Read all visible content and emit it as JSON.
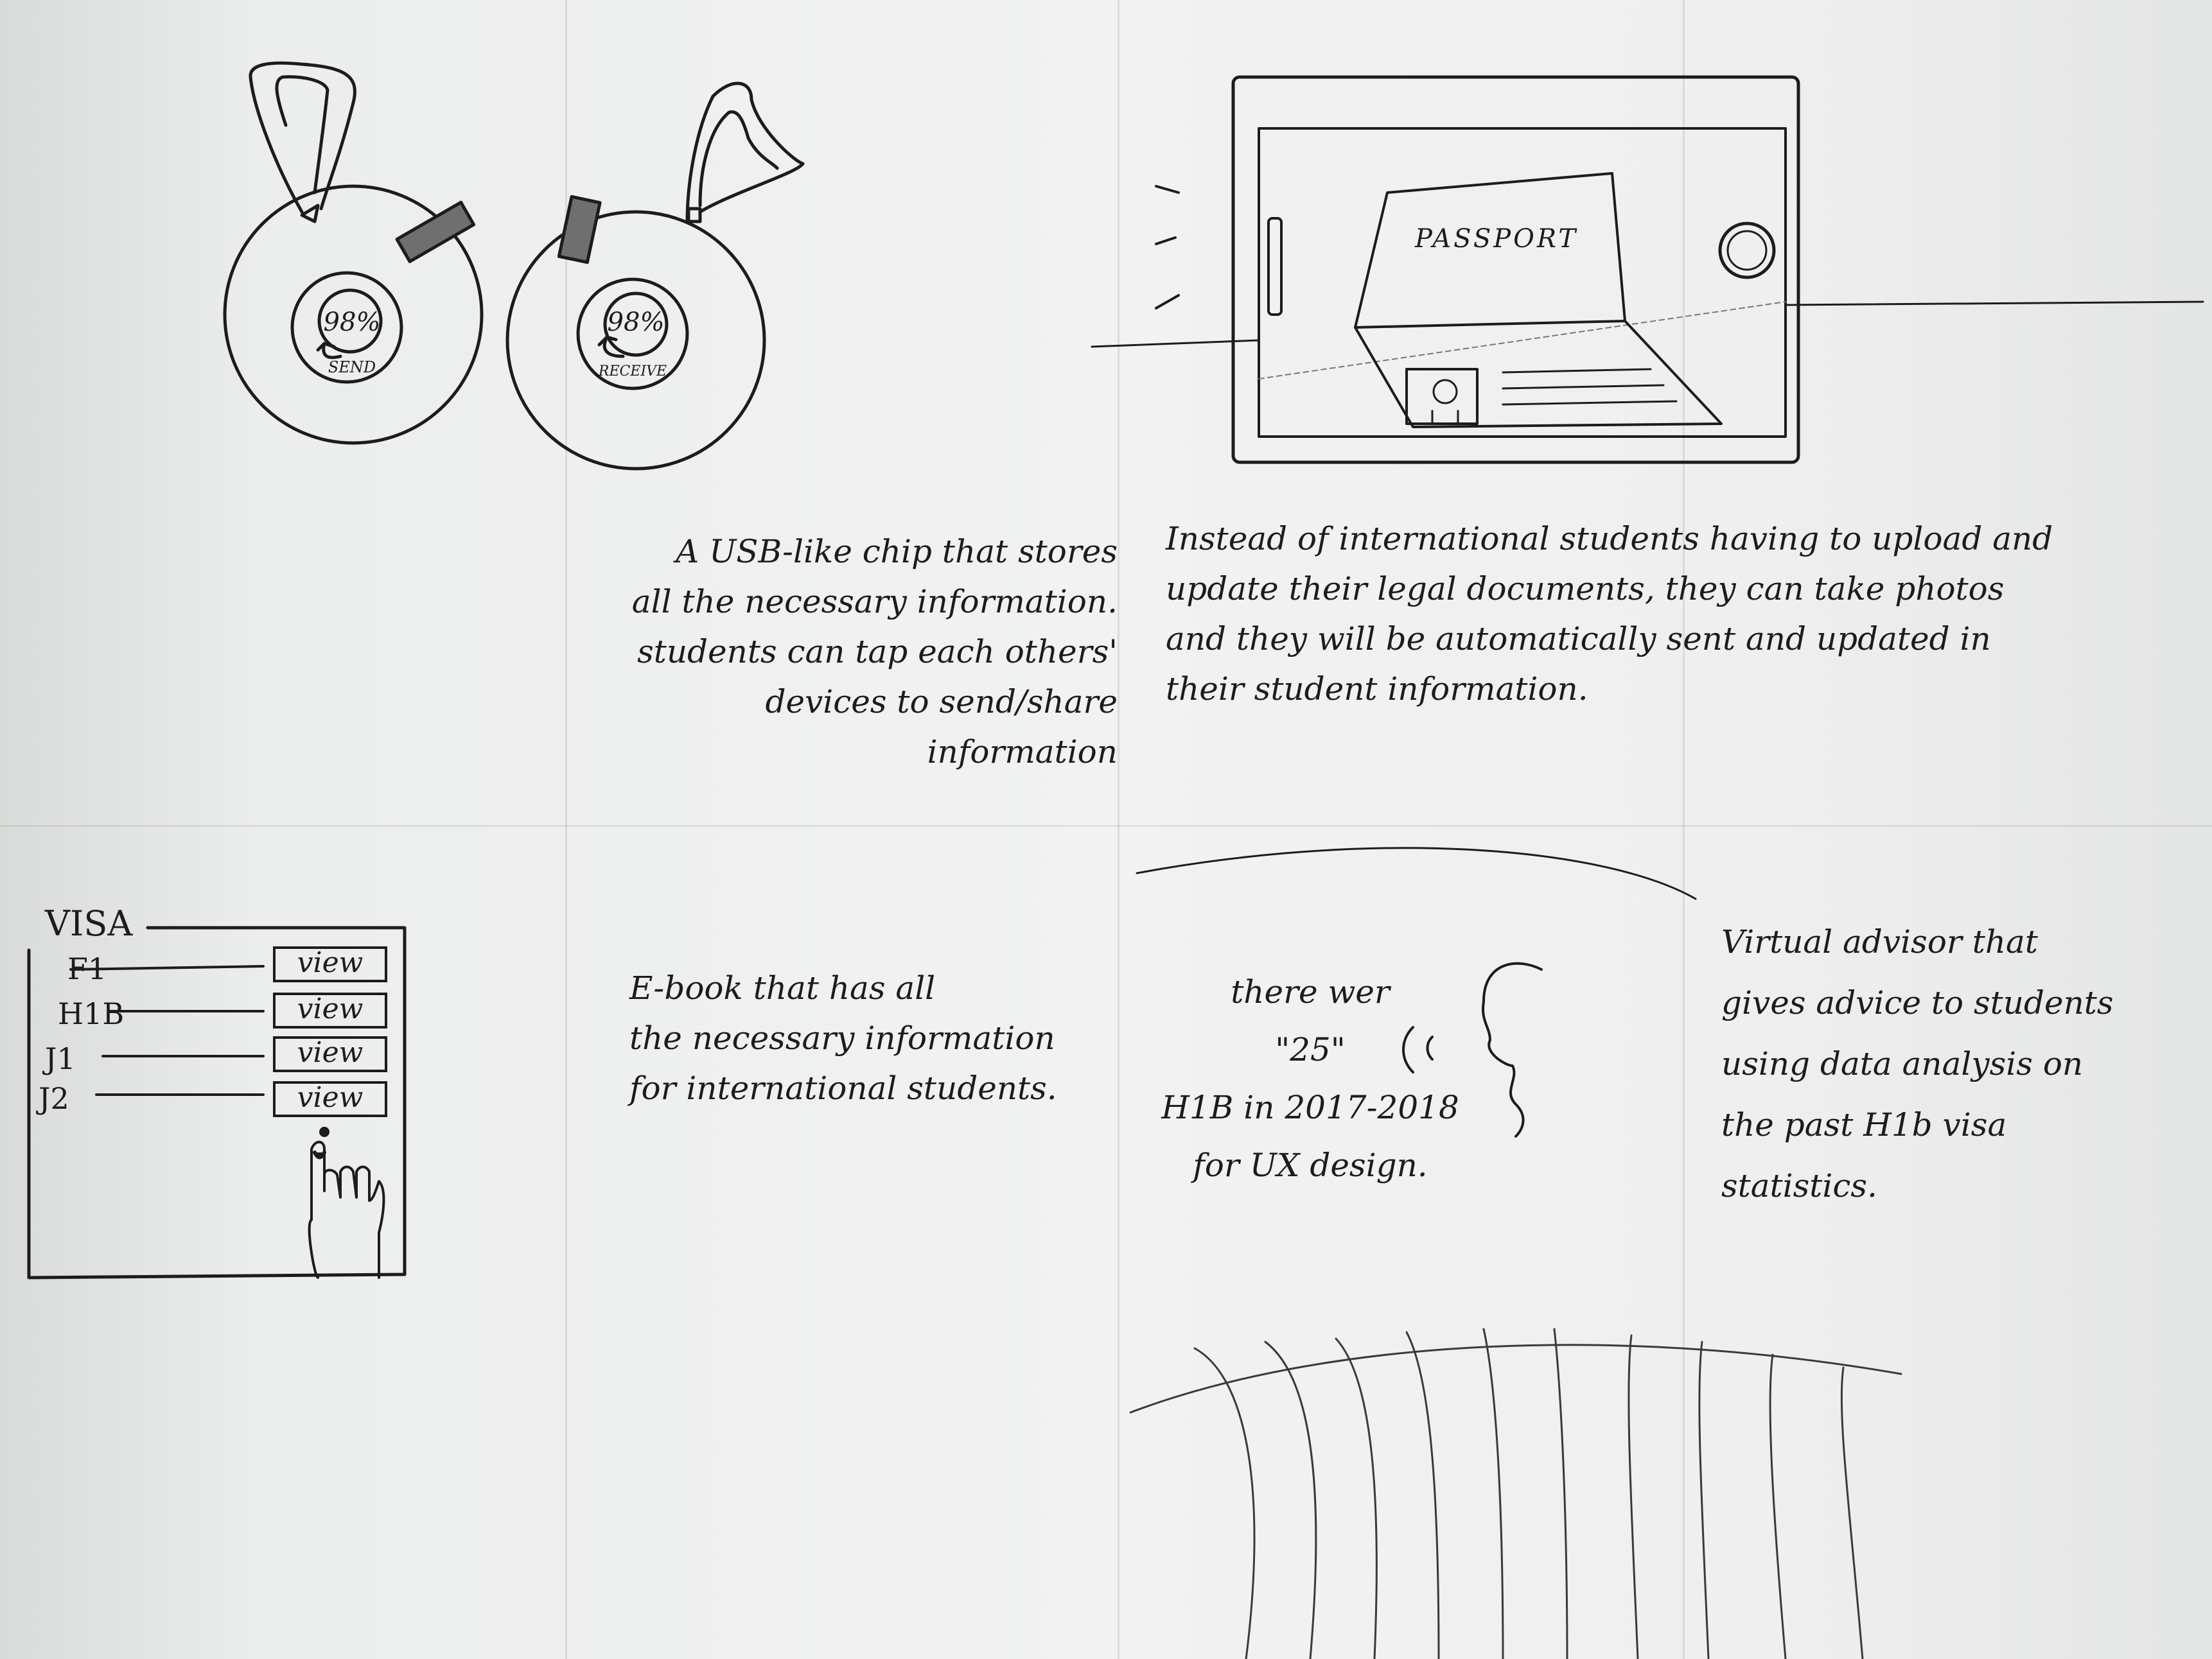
{
  "usb_devices": {
    "send_device": {
      "percent": "98%",
      "label": "SEND"
    },
    "receive_device": {
      "percent": "98%",
      "label": "RECEIVE"
    }
  },
  "usb_note": "A USB-like chip that stores\nall the necessary information.\nstudents can tap each others'\ndevices to send/share information",
  "tablet": {
    "passport_label": "PASSPORT"
  },
  "tablet_note": "Instead of international students having to upload and\nupdate their legal documents, they can take photos\nand they will be automatically sent and updated in\ntheir student information.",
  "visa_screen": {
    "heading": "VISA",
    "rows": [
      {
        "type": "F1",
        "button": "view"
      },
      {
        "type": "H1B",
        "button": "view"
      },
      {
        "type": "J1",
        "button": "view"
      },
      {
        "type": "J2",
        "button": "view"
      }
    ]
  },
  "ebook_note": "E-book that has all\nthe necessary information\nfor international students.",
  "advisor_speech": "there wer\n\"25\"\nH1B in 2017-2018\nfor UX design.",
  "advisor_note": "Virtual advisor that\ngives advice to students\nusing data analysis on\nthe past H1b visa\nstatistics."
}
